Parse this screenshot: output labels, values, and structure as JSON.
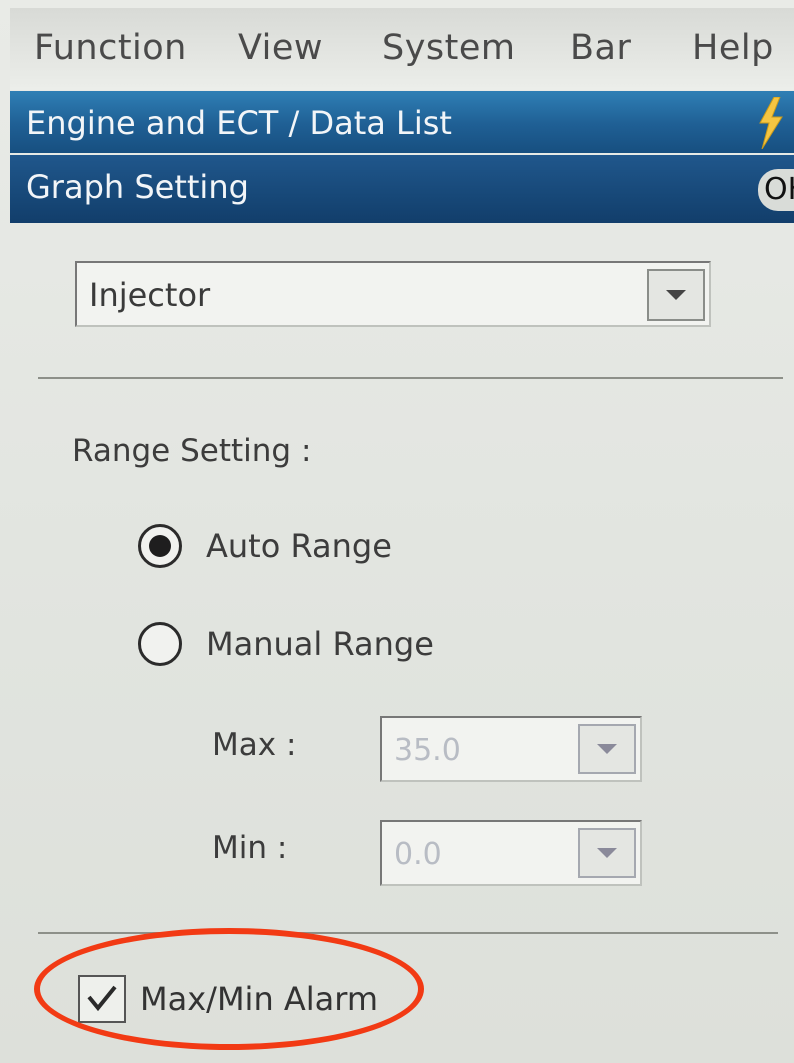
{
  "menu": {
    "items": [
      "Function",
      "View",
      "System",
      "Bar",
      "Help"
    ]
  },
  "header": {
    "breadcrumb": "Engine and ECT / Data List",
    "dialog_title": "Graph Setting",
    "ok_label": "OK"
  },
  "sensor_select": {
    "value": "Injector"
  },
  "range": {
    "label": "Range Setting :",
    "auto_label": "Auto Range",
    "manual_label": "Manual Range",
    "selected": "Auto Range",
    "max_label": "Max :",
    "max_value": "35.0",
    "min_label": "Min :",
    "min_value": "0.0"
  },
  "alarm": {
    "label": "Max/Min Alarm",
    "checked": true
  },
  "colors": {
    "title_bar": "#1f5f94",
    "highlight": "#f23a14"
  },
  "icons": [
    "lightning-bolt-icon",
    "chevron-down-icon",
    "radio-selected-icon",
    "radio-unselected-icon",
    "checkmark-icon"
  ]
}
